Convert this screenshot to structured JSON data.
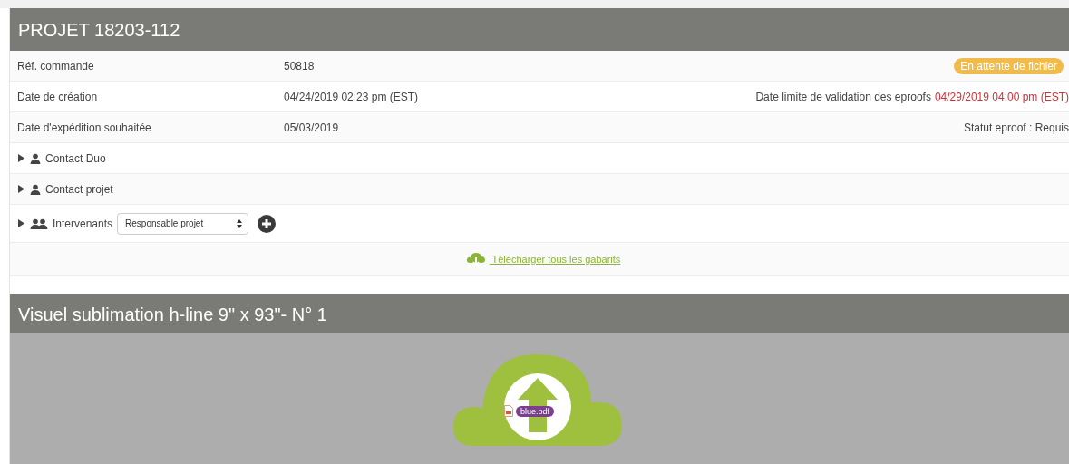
{
  "project": {
    "title": "PROJET 18203-112",
    "rows": [
      {
        "kind": "field",
        "label": "Réf. commande",
        "value": "50818",
        "right": {
          "kind": "badge",
          "text": "En attente de fichier"
        }
      },
      {
        "kind": "field",
        "label": "Date de création",
        "value": "04/24/2019 02:23 pm (EST)",
        "right": {
          "kind": "text",
          "label": "Date limite de validation des eproofs",
          "value": "04/29/2019 04:00 pm (EST)"
        }
      },
      {
        "kind": "field",
        "label": "Date d'expédition souhaitée",
        "value": "05/03/2019",
        "right": {
          "kind": "text",
          "label": "Statut eproof : Requis"
        }
      },
      {
        "kind": "contact",
        "label": "Contact Duo",
        "expanded": false
      },
      {
        "kind": "contact",
        "label": "Contact projet",
        "expanded": false
      },
      {
        "kind": "team",
        "label": "Intervenants",
        "expanded": false,
        "select": "Responsable projet",
        "add": true
      }
    ],
    "download_link": "Télécharger tous les gabarits"
  },
  "visual": {
    "title": "Visuel sublimation h-line 9\" x 93\"- N° 1",
    "dragged_file": "blue.pdf"
  }
}
